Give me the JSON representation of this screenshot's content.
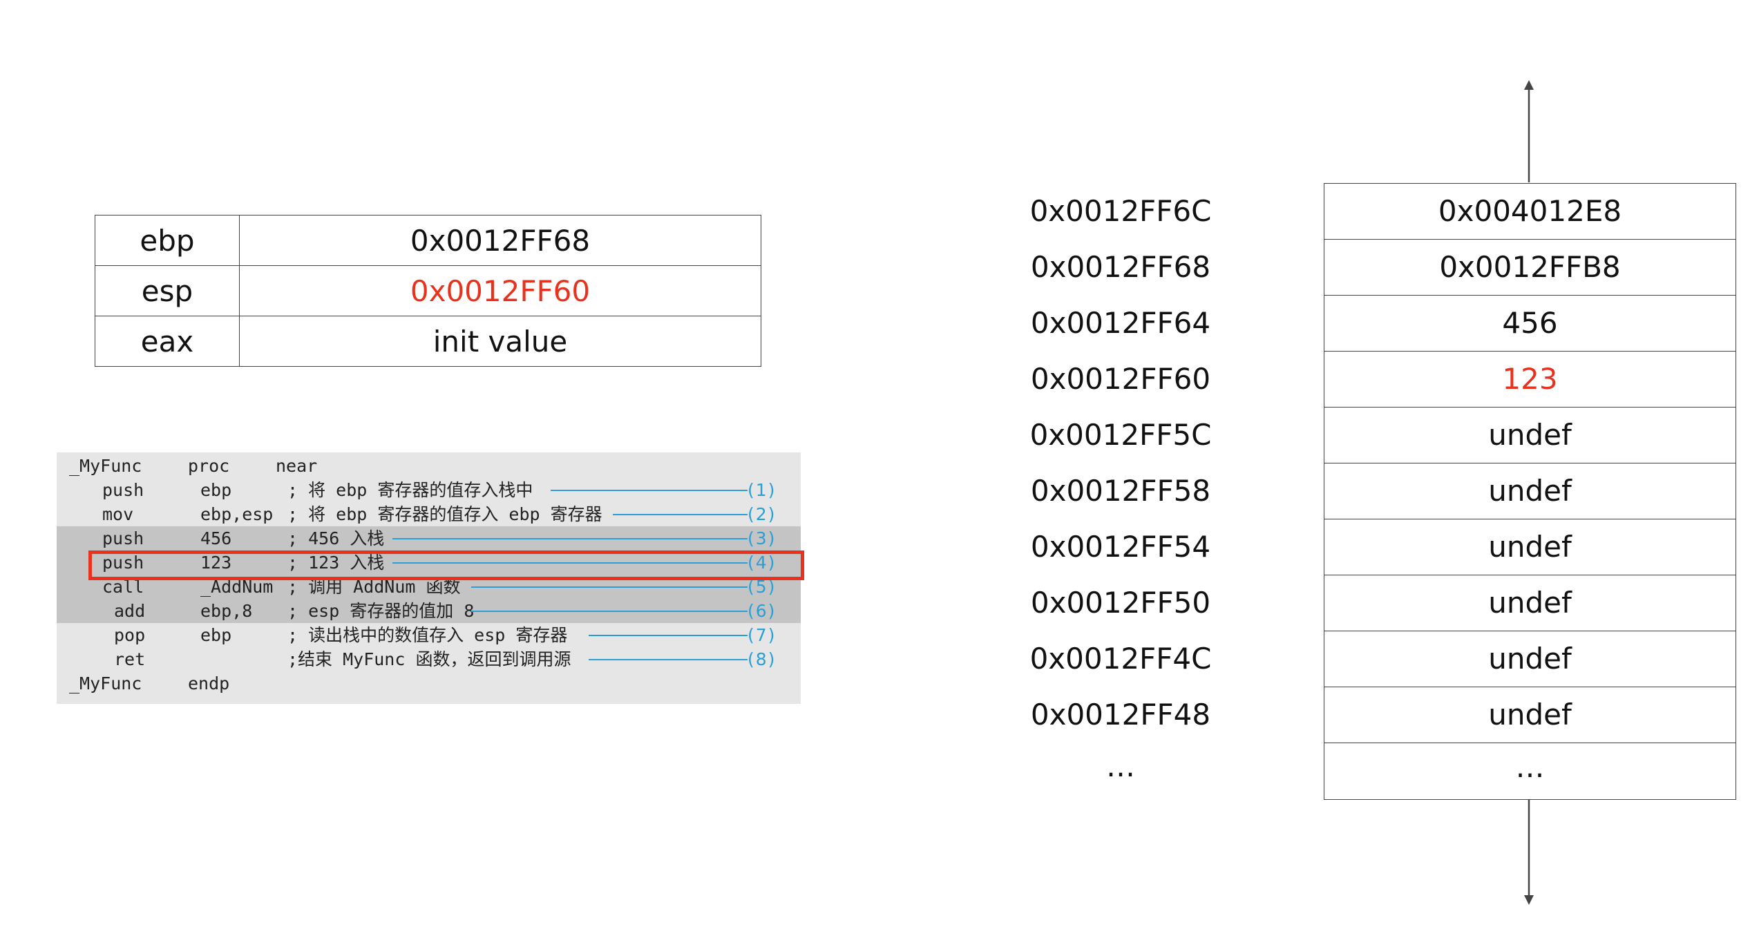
{
  "registers": [
    {
      "name": "ebp",
      "value": "0x0012FF68",
      "highlight": false
    },
    {
      "name": "esp",
      "value": "0x0012FF60",
      "highlight": true
    },
    {
      "name": "eax",
      "value": "init value",
      "highlight": false
    }
  ],
  "code": {
    "lines": [
      {
        "label": "_MyFunc",
        "proc": "proc",
        "near": "near"
      },
      {
        "op": "push",
        "arg": "ebp",
        "comment": "; 将 ebp 寄存器的值存入栈中",
        "num": "(1)"
      },
      {
        "op": "mov",
        "arg": "ebp,esp",
        "comment": "; 将 ebp 寄存器的值存入 ebp 寄存器",
        "num": "(2)"
      },
      {
        "op": "push",
        "arg": "456",
        "comment": "; 456 入栈",
        "num": "(3)"
      },
      {
        "op": "push",
        "arg": "123",
        "comment": "; 123 入栈",
        "num": "(4)"
      },
      {
        "op": "call",
        "arg": "_AddNum",
        "comment": "; 调用 AddNum 函数",
        "num": "(5)"
      },
      {
        "op": "add",
        "arg": "ebp,8",
        "comment": "; esp 寄存器的值加 8",
        "num": "(6)"
      },
      {
        "op": "pop",
        "arg": "ebp",
        "comment": "; 读出栈中的数值存入 esp 寄存器",
        "num": "(7)"
      },
      {
        "op": "ret",
        "arg": "",
        "comment": ";结束 MyFunc 函数，返回到调用源",
        "num": "(8)"
      },
      {
        "label": "_MyFunc",
        "proc": "endp"
      }
    ],
    "highlighted_line": "(4)"
  },
  "stack": {
    "addresses": [
      "0x0012FF6C",
      "0x0012FF68",
      "0x0012FF64",
      "0x0012FF60",
      "0x0012FF5C",
      "0x0012FF58",
      "0x0012FF54",
      "0x0012FF50",
      "0x0012FF4C",
      "0x0012FF48",
      "…"
    ],
    "values": [
      {
        "text": "0x004012E8",
        "highlight": false
      },
      {
        "text": "0x0012FFB8",
        "highlight": false
      },
      {
        "text": "456",
        "highlight": false
      },
      {
        "text": "123",
        "highlight": true
      },
      {
        "text": "undef",
        "highlight": false
      },
      {
        "text": "undef",
        "highlight": false
      },
      {
        "text": "undef",
        "highlight": false
      },
      {
        "text": "undef",
        "highlight": false
      },
      {
        "text": "undef",
        "highlight": false
      },
      {
        "text": "undef",
        "highlight": false
      },
      {
        "text": "…",
        "highlight": false
      }
    ]
  },
  "colors": {
    "highlight_red": "#e8321d",
    "annotation_blue": "#2a9fd6",
    "code_bg": "#e6e6e6",
    "code_highlight_bg": "#c4c4c4"
  }
}
